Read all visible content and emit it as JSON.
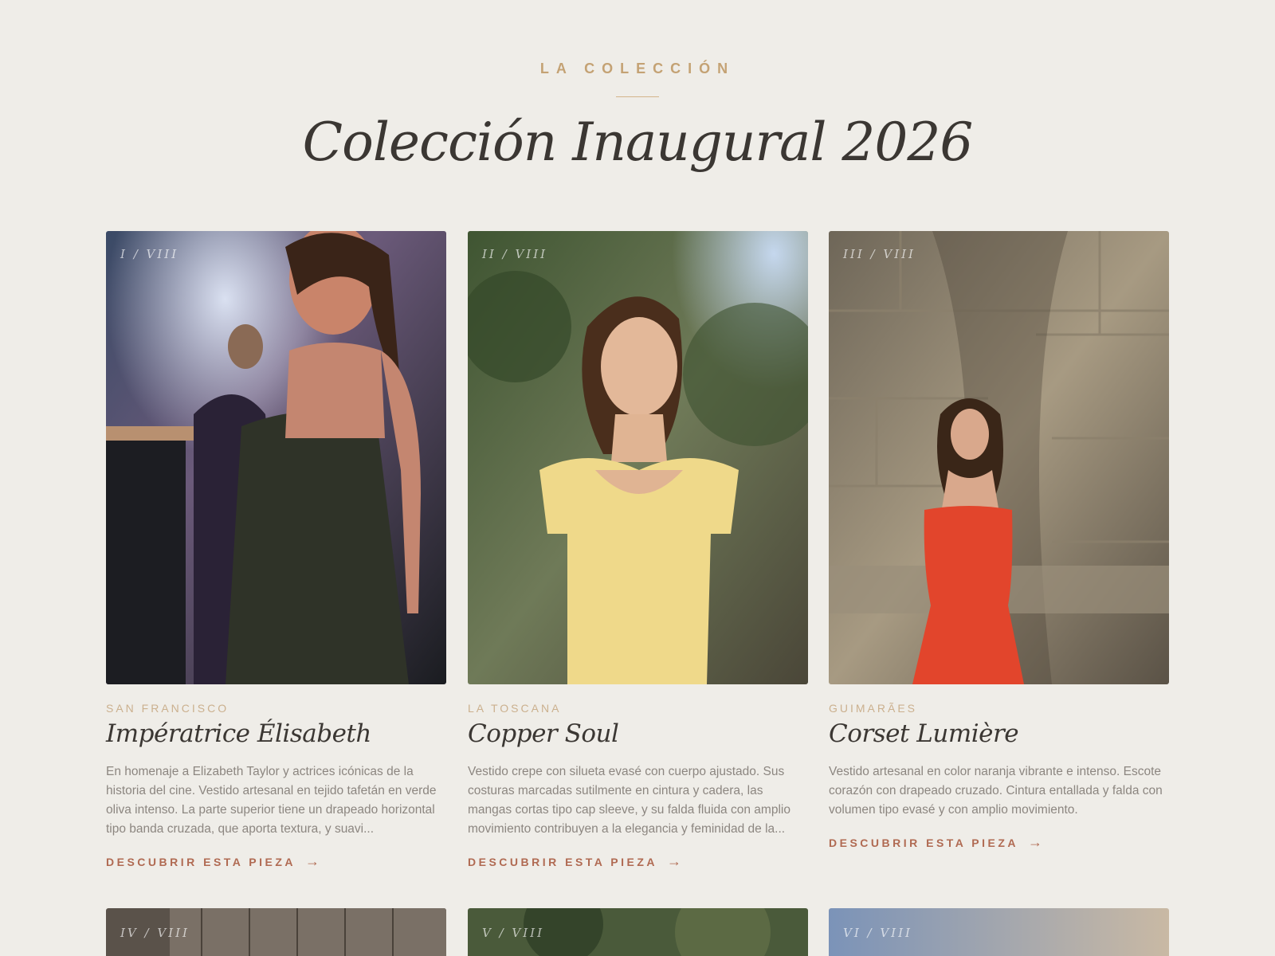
{
  "section": {
    "eyebrow": "LA COLECCIÓN",
    "title": "Colección Inaugural 2026"
  },
  "cards": [
    {
      "index": "I / VIII",
      "location": "SAN FRANCISCO",
      "title": "Impératrice Élisabeth",
      "description": "En homenaje a Elizabeth Taylor y actrices icónicas de la historia del cine. Vestido artesanal en tejido tafetán en verde oliva intenso. La parte superior tiene un drapeado horizontal tipo banda cruzada, que aporta textura, y suavi...",
      "cta": "DESCUBRIR ESTA PIEZA",
      "dress_color": "#2f3328"
    },
    {
      "index": "II / VIII",
      "location": "LA TOSCANA",
      "title": "Copper Soul",
      "description": "Vestido crepe con silueta evasé con cuerpo ajustado. Sus costuras marcadas sutilmente en cintura y cadera, las mangas cortas tipo cap sleeve, y su falda fluida con amplio movimiento contribuyen a la elegancia y feminidad de la...",
      "cta": "DESCUBRIR ESTA PIEZA",
      "dress_color": "#efd98a"
    },
    {
      "index": "III / VIII",
      "location": "GUIMARÃES",
      "title": "Corset Lumière",
      "description": "Vestido artesanal en color naranja vibrante e intenso. Escote corazón con drapeado cruzado. Cintura entallada y falda con volumen tipo evasé y con amplio movimiento.",
      "cta": "DESCUBRIR ESTA PIEZA",
      "dress_color": "#e2452c"
    }
  ],
  "next_row": [
    {
      "index": "IV / VIII"
    },
    {
      "index": "V / VIII"
    },
    {
      "index": "VI / VIII"
    }
  ],
  "colors": {
    "background": "#efede8",
    "accent_gold": "#c4a274",
    "cta": "#b06a52"
  },
  "icons": {
    "cta_arrow": "→"
  }
}
